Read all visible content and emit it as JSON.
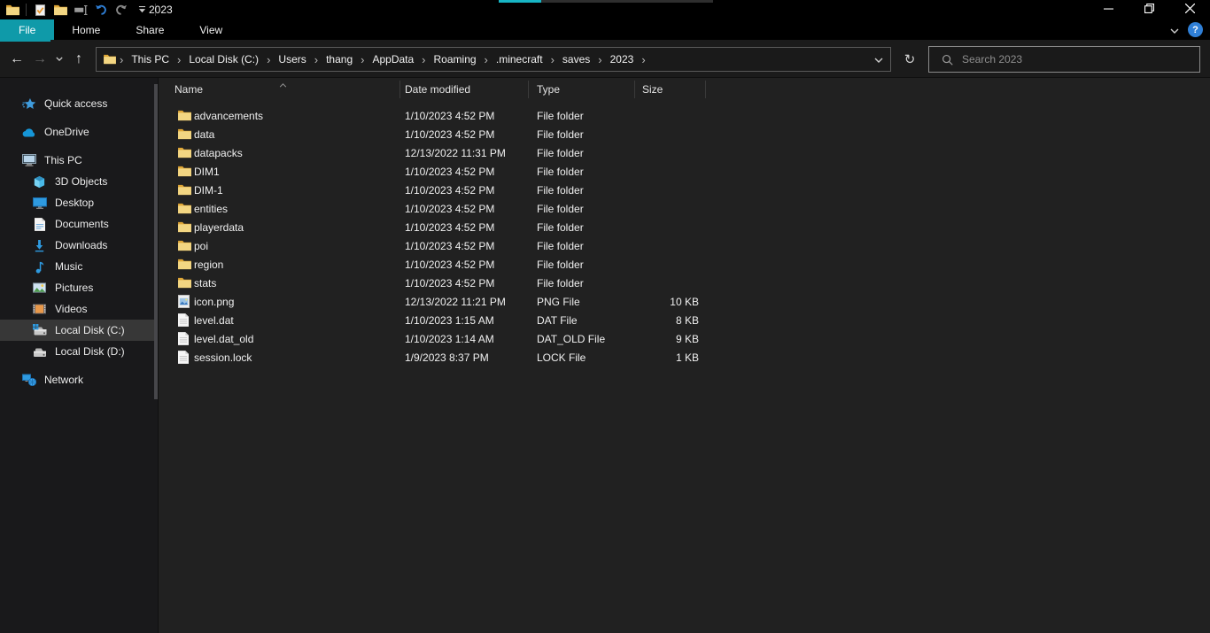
{
  "window": {
    "title": "2023"
  },
  "titlebar": {
    "qat": [
      "explorer",
      "separator",
      "properties",
      "new-folder",
      "rename",
      "undo",
      "redo",
      "qat-dropdown",
      "separator"
    ]
  },
  "ribbon": {
    "tabs": [
      {
        "label": "File",
        "active": true
      },
      {
        "label": "Home",
        "active": false
      },
      {
        "label": "Share",
        "active": false
      },
      {
        "label": "View",
        "active": false
      }
    ]
  },
  "toolbar": {
    "nav": [
      {
        "icon": "back-arrow",
        "enabled": true
      },
      {
        "icon": "forward-arrow",
        "enabled": false
      },
      {
        "icon": "recent-locations-chevron",
        "enabled": true
      },
      {
        "icon": "up-arrow",
        "enabled": true
      }
    ],
    "breadcrumb": [
      "This PC",
      "Local Disk (C:)",
      "Users",
      "thang",
      "AppData",
      "Roaming",
      ".minecraft",
      "saves",
      "2023"
    ]
  },
  "search": {
    "placeholder": "Search 2023"
  },
  "sidebar": {
    "items": [
      {
        "label": "Quick access",
        "icon": "quick-access-star",
        "level": 0,
        "gap_before": false,
        "selected": false
      },
      {
        "label": "OneDrive",
        "icon": "onedrive-cloud",
        "level": 0,
        "gap_before": true,
        "selected": false
      },
      {
        "label": "This PC",
        "icon": "this-pc-monitor",
        "level": 0,
        "gap_before": true,
        "selected": false
      },
      {
        "label": "3D Objects",
        "icon": "3d-objects-cube",
        "level": 1,
        "gap_before": false,
        "selected": false
      },
      {
        "label": "Desktop",
        "icon": "desktop-monitor",
        "level": 1,
        "gap_before": false,
        "selected": false
      },
      {
        "label": "Documents",
        "icon": "documents-file",
        "level": 1,
        "gap_before": false,
        "selected": false
      },
      {
        "label": "Downloads",
        "icon": "downloads-arrow",
        "level": 1,
        "gap_before": false,
        "selected": false
      },
      {
        "label": "Music",
        "icon": "music-note",
        "level": 1,
        "gap_before": false,
        "selected": false
      },
      {
        "label": "Pictures",
        "icon": "pictures-photo",
        "level": 1,
        "gap_before": false,
        "selected": false
      },
      {
        "label": "Videos",
        "icon": "videos-film",
        "level": 1,
        "gap_before": false,
        "selected": false
      },
      {
        "label": "Local Disk (C:)",
        "icon": "local-disk-windows",
        "level": 1,
        "gap_before": false,
        "selected": true
      },
      {
        "label": "Local Disk (D:)",
        "icon": "local-disk",
        "level": 1,
        "gap_before": false,
        "selected": false
      },
      {
        "label": "Network",
        "icon": "network-computers",
        "level": 0,
        "gap_before": true,
        "selected": false
      }
    ]
  },
  "filelist": {
    "columns": [
      {
        "label": "Name",
        "sort": "ascending"
      },
      {
        "label": "Date modified",
        "sort": ""
      },
      {
        "label": "Type",
        "sort": ""
      },
      {
        "label": "Size",
        "sort": ""
      }
    ],
    "rows": [
      {
        "name": "advancements",
        "date": "1/10/2023 4:52 PM",
        "type": "File folder",
        "size": "",
        "icon": "folder"
      },
      {
        "name": "data",
        "date": "1/10/2023 4:52 PM",
        "type": "File folder",
        "size": "",
        "icon": "folder"
      },
      {
        "name": "datapacks",
        "date": "12/13/2022 11:31 PM",
        "type": "File folder",
        "size": "",
        "icon": "folder"
      },
      {
        "name": "DIM1",
        "date": "1/10/2023 4:52 PM",
        "type": "File folder",
        "size": "",
        "icon": "folder"
      },
      {
        "name": "DIM-1",
        "date": "1/10/2023 4:52 PM",
        "type": "File folder",
        "size": "",
        "icon": "folder"
      },
      {
        "name": "entities",
        "date": "1/10/2023 4:52 PM",
        "type": "File folder",
        "size": "",
        "icon": "folder"
      },
      {
        "name": "playerdata",
        "date": "1/10/2023 4:52 PM",
        "type": "File folder",
        "size": "",
        "icon": "folder"
      },
      {
        "name": "poi",
        "date": "1/10/2023 4:52 PM",
        "type": "File folder",
        "size": "",
        "icon": "folder"
      },
      {
        "name": "region",
        "date": "1/10/2023 4:52 PM",
        "type": "File folder",
        "size": "",
        "icon": "folder"
      },
      {
        "name": "stats",
        "date": "1/10/2023 4:52 PM",
        "type": "File folder",
        "size": "",
        "icon": "folder"
      },
      {
        "name": "icon.png",
        "date": "12/13/2022 11:21 PM",
        "type": "PNG File",
        "size": "10 KB",
        "icon": "image-file"
      },
      {
        "name": "level.dat",
        "date": "1/10/2023 1:15 AM",
        "type": "DAT File",
        "size": "8 KB",
        "icon": "file"
      },
      {
        "name": "level.dat_old",
        "date": "1/10/2023 1:14 AM",
        "type": "DAT_OLD File",
        "size": "9 KB",
        "icon": "file"
      },
      {
        "name": "session.lock",
        "date": "1/9/2023 8:37 PM",
        "type": "LOCK File",
        "size": "1 KB",
        "icon": "file"
      }
    ]
  },
  "colors": {
    "accent": "#0f9aa9",
    "progress_teal": "#17b5c4",
    "folder_yellow": "#f3d682"
  }
}
